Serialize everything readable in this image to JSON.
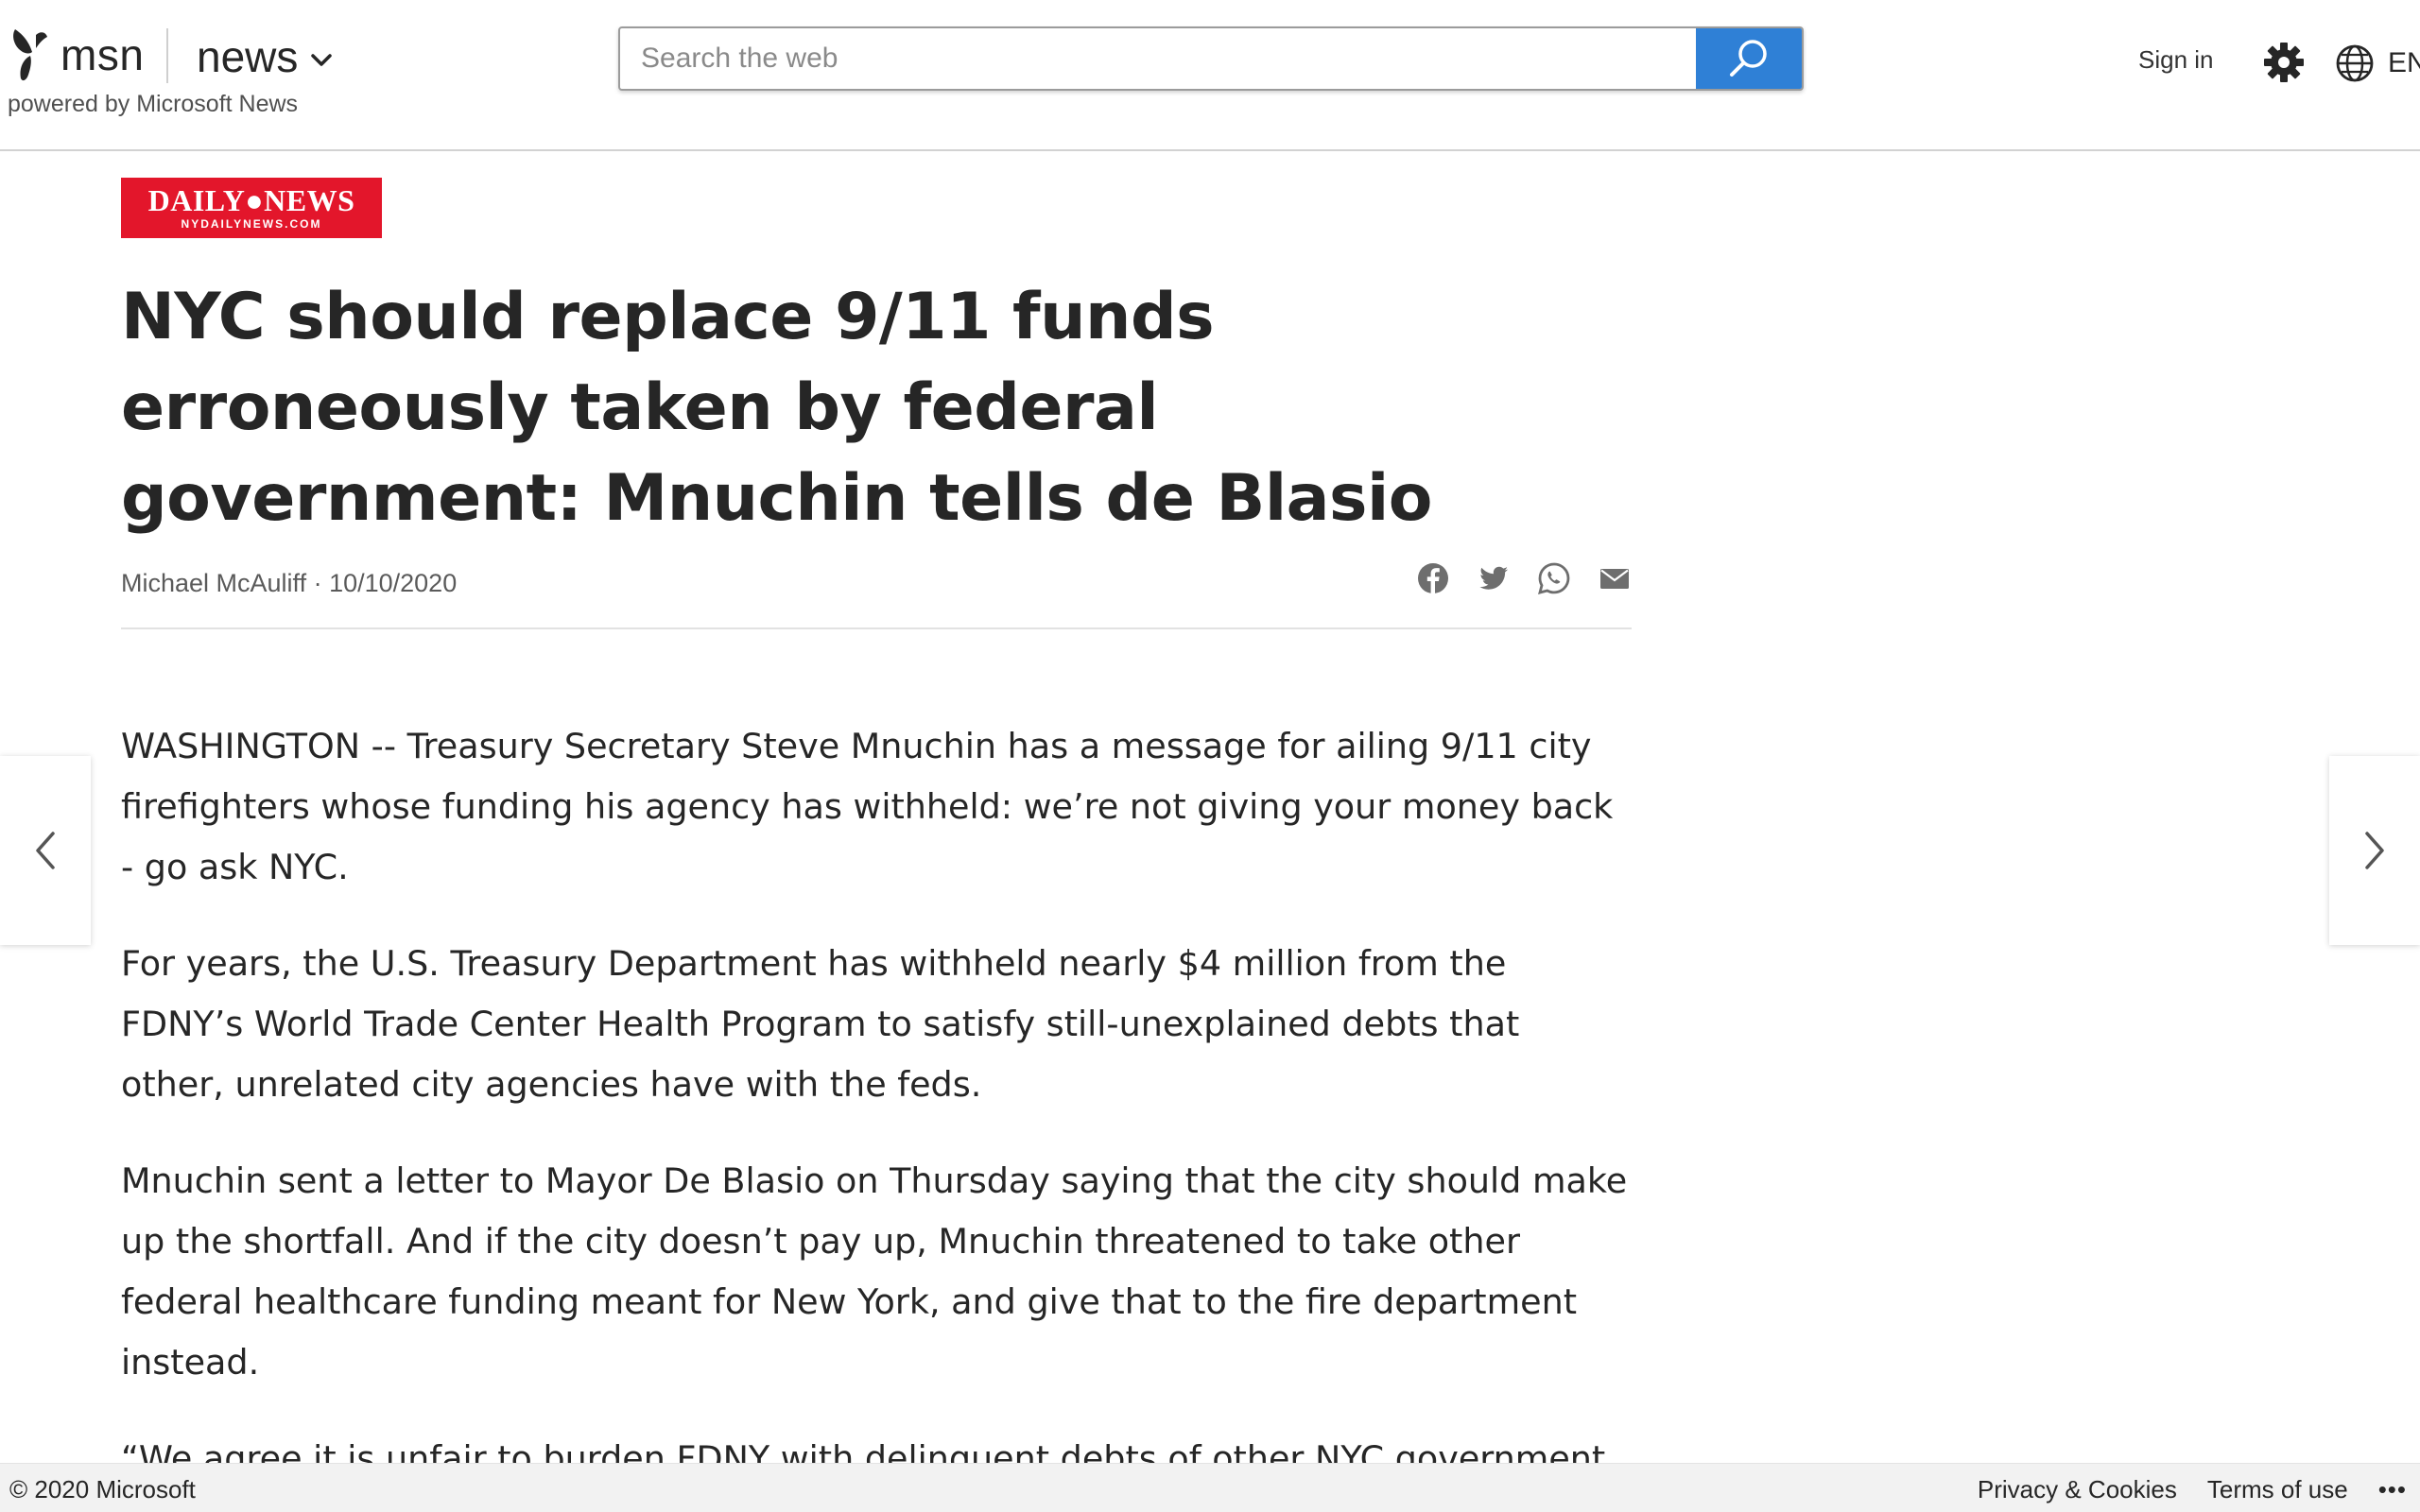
{
  "header": {
    "brand": "msn",
    "section": "news",
    "powered_by": "powered by Microsoft News",
    "search_placeholder": "Search the web",
    "sign_in": "Sign in",
    "language": "EN",
    "search_button_color": "#2f80d6"
  },
  "article": {
    "publisher_logo": {
      "main": "DAILY●NEWS",
      "sub": "NYDAILYNEWS.COM",
      "color": "#e3162b"
    },
    "headline": "NYC should replace 9/11 funds erroneously taken by federal government: Mnuchin tells de Blasio",
    "author": "Michael McAuliff",
    "date": "10/10/2020",
    "share_icons": [
      "facebook-icon",
      "twitter-icon",
      "whatsapp-icon",
      "email-icon"
    ],
    "paragraphs": [
      "WASHINGTON -- Treasury Secretary Steve Mnuchin has a message for ailing 9/11 city firefighters whose funding his agency has withheld: we’re not giving your money back - go ask NYC.",
      "For years, the U.S. Treasury Department has withheld nearly $4 million from the FDNY’s World Trade Center Health Program to satisfy still-unexplained debts that other, unrelated city agencies have with the feds.",
      "Mnuchin sent a letter to Mayor De Blasio on Thursday saying that the city should make up the shortfall. And if the city doesn’t pay up, Mnuchin threatened to take other federal healthcare funding meant for New York, and give that to the fire department instead.",
      "“We agree it is unfair to burden FDNY with delinquent debts of other NYC government entities. The City government should directly reimburse FDNY,” Mnuchin wrote."
    ]
  },
  "footer": {
    "copyright": "© 2020 Microsoft",
    "privacy": "Privacy & Cookies",
    "terms": "Terms of use",
    "more": "•••"
  }
}
